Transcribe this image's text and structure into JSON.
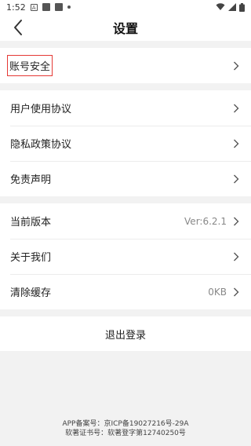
{
  "status_bar": {
    "time": "1:52",
    "a_icon": "A"
  },
  "header": {
    "title": "设置",
    "back_icon": "chevron-left-icon"
  },
  "groups": [
    {
      "items": [
        {
          "label": "账号安全",
          "highlighted": true
        }
      ]
    },
    {
      "items": [
        {
          "label": "用户使用协议"
        },
        {
          "label": "隐私政策协议"
        },
        {
          "label": "免责声明"
        }
      ]
    },
    {
      "items": [
        {
          "label": "当前版本",
          "value": "Ver:6.2.1"
        },
        {
          "label": "关于我们"
        },
        {
          "label": "清除缓存",
          "value": "0KB"
        }
      ]
    }
  ],
  "logout_label": "退出登录",
  "footer": {
    "app_record_label": "APP备案号：",
    "app_record_value": "京ICP备19027216号-29A",
    "software_label": "软著证书号：",
    "software_value": "软著登字第12740250号"
  },
  "colors": {
    "highlight_border": "#e53935",
    "background": "#f2f2f2"
  }
}
